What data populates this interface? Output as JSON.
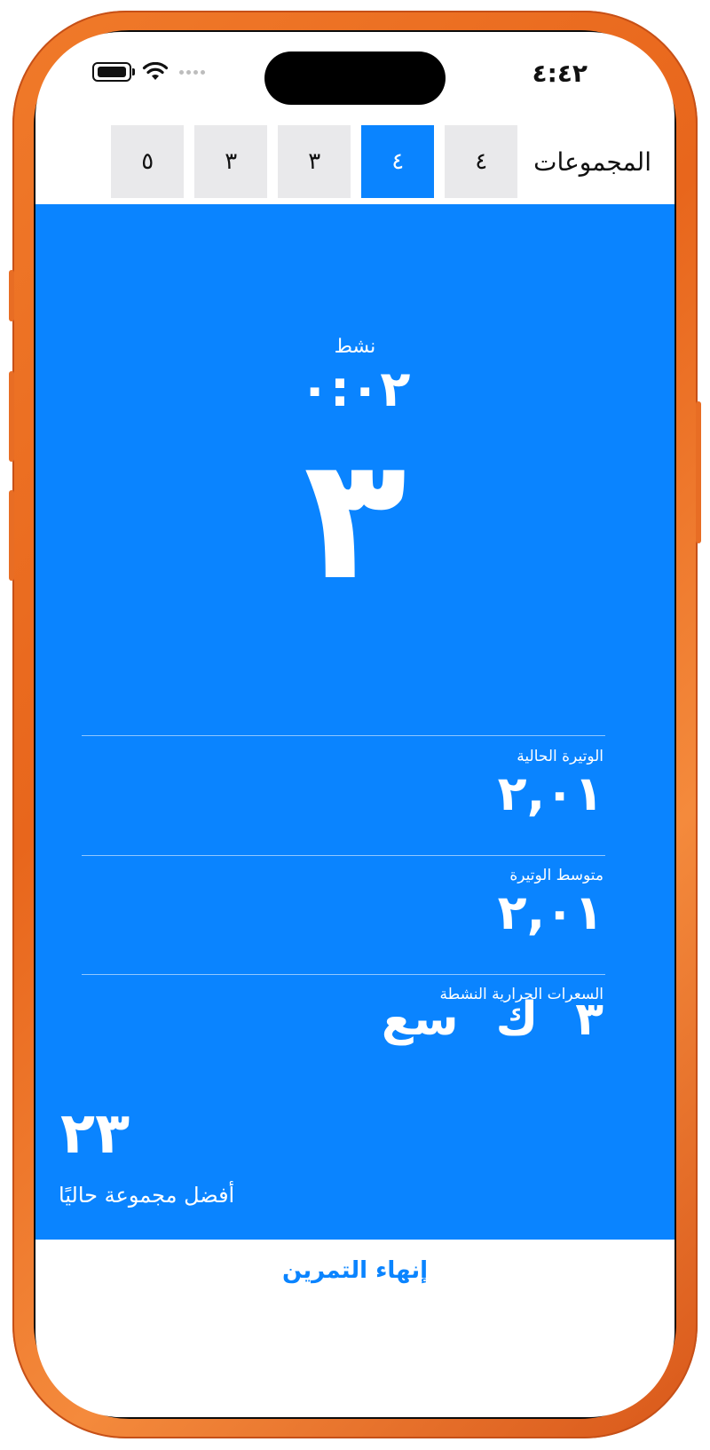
{
  "status_bar": {
    "time": "٤:٤٢"
  },
  "sets": {
    "label": "المجموعات",
    "items": [
      {
        "value": "٤",
        "active": false
      },
      {
        "value": "٤",
        "active": true
      },
      {
        "value": "٣",
        "active": false
      },
      {
        "value": "٣",
        "active": false
      },
      {
        "value": "٥",
        "active": false
      }
    ]
  },
  "workout": {
    "state_label": "نشط",
    "timer": "٠:٠٢",
    "current_count": "٣"
  },
  "stats": {
    "current_pace_label": "الوتيرة الحالية",
    "current_pace_value": "٢,٠١",
    "average_pace_label": "متوسط الوتيرة",
    "average_pace_value": "٢,٠١",
    "active_calories_label": "السعرات الحرارية النشطة",
    "active_calories_value": "٣",
    "active_calories_unit": "ك",
    "active_calories_unit2": "سع"
  },
  "best_set": {
    "value": "٢٣",
    "label": "أفضل مجموعة حاليًا"
  },
  "actions": {
    "end_workout": "إنهاء التمرين"
  },
  "colors": {
    "accent": "#0a84ff",
    "frame": "#e8661c"
  }
}
